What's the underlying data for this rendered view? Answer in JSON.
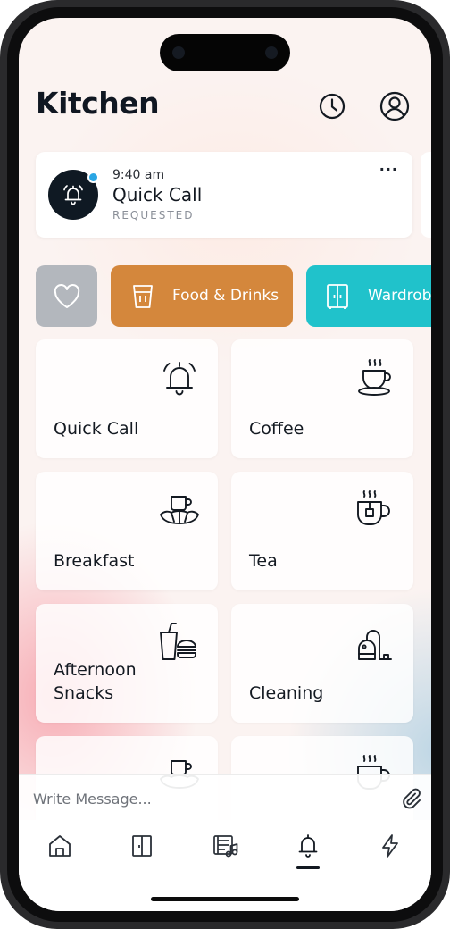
{
  "header": {
    "title": "Kitchen",
    "history_icon": "clock-icon",
    "profile_icon": "user-circle-icon"
  },
  "request": {
    "time": "9:40 am",
    "name": "Quick Call",
    "status": "REQUESTED",
    "icon": "alarm-bell-icon",
    "indicator_color": "#2aa6e4",
    "more_label": "···"
  },
  "categories": [
    {
      "id": "favorites",
      "label": "",
      "icon": "heart-icon",
      "color": "#b3b7bd"
    },
    {
      "id": "food",
      "label": "Food & Drinks",
      "icon": "cup-icon",
      "color": "#d4873c"
    },
    {
      "id": "wardrobe",
      "label": "Wardrob",
      "icon": "wardrobe-icon",
      "color": "#20c2cb"
    }
  ],
  "tiles": [
    {
      "label": "Quick Call",
      "icon": "alarm-bell-icon"
    },
    {
      "label": "Coffee",
      "icon": "coffee-cup-icon"
    },
    {
      "label": "Breakfast",
      "icon": "breakfast-icon"
    },
    {
      "label": "Tea",
      "icon": "tea-cup-icon"
    },
    {
      "label_line1": "Afternoon",
      "label_line2": "Snacks",
      "icon": "snacks-icon"
    },
    {
      "label": "Cleaning",
      "icon": "vacuum-icon"
    }
  ],
  "message": {
    "placeholder": "Write Message...",
    "attach_icon": "paperclip-icon"
  },
  "tabbar": {
    "items": [
      {
        "id": "home",
        "icon": "home-icon"
      },
      {
        "id": "rooms",
        "icon": "door-icon"
      },
      {
        "id": "media",
        "icon": "media-icon"
      },
      {
        "id": "notifications",
        "icon": "bell-icon",
        "active": true
      },
      {
        "id": "quick",
        "icon": "lightning-icon"
      }
    ]
  }
}
